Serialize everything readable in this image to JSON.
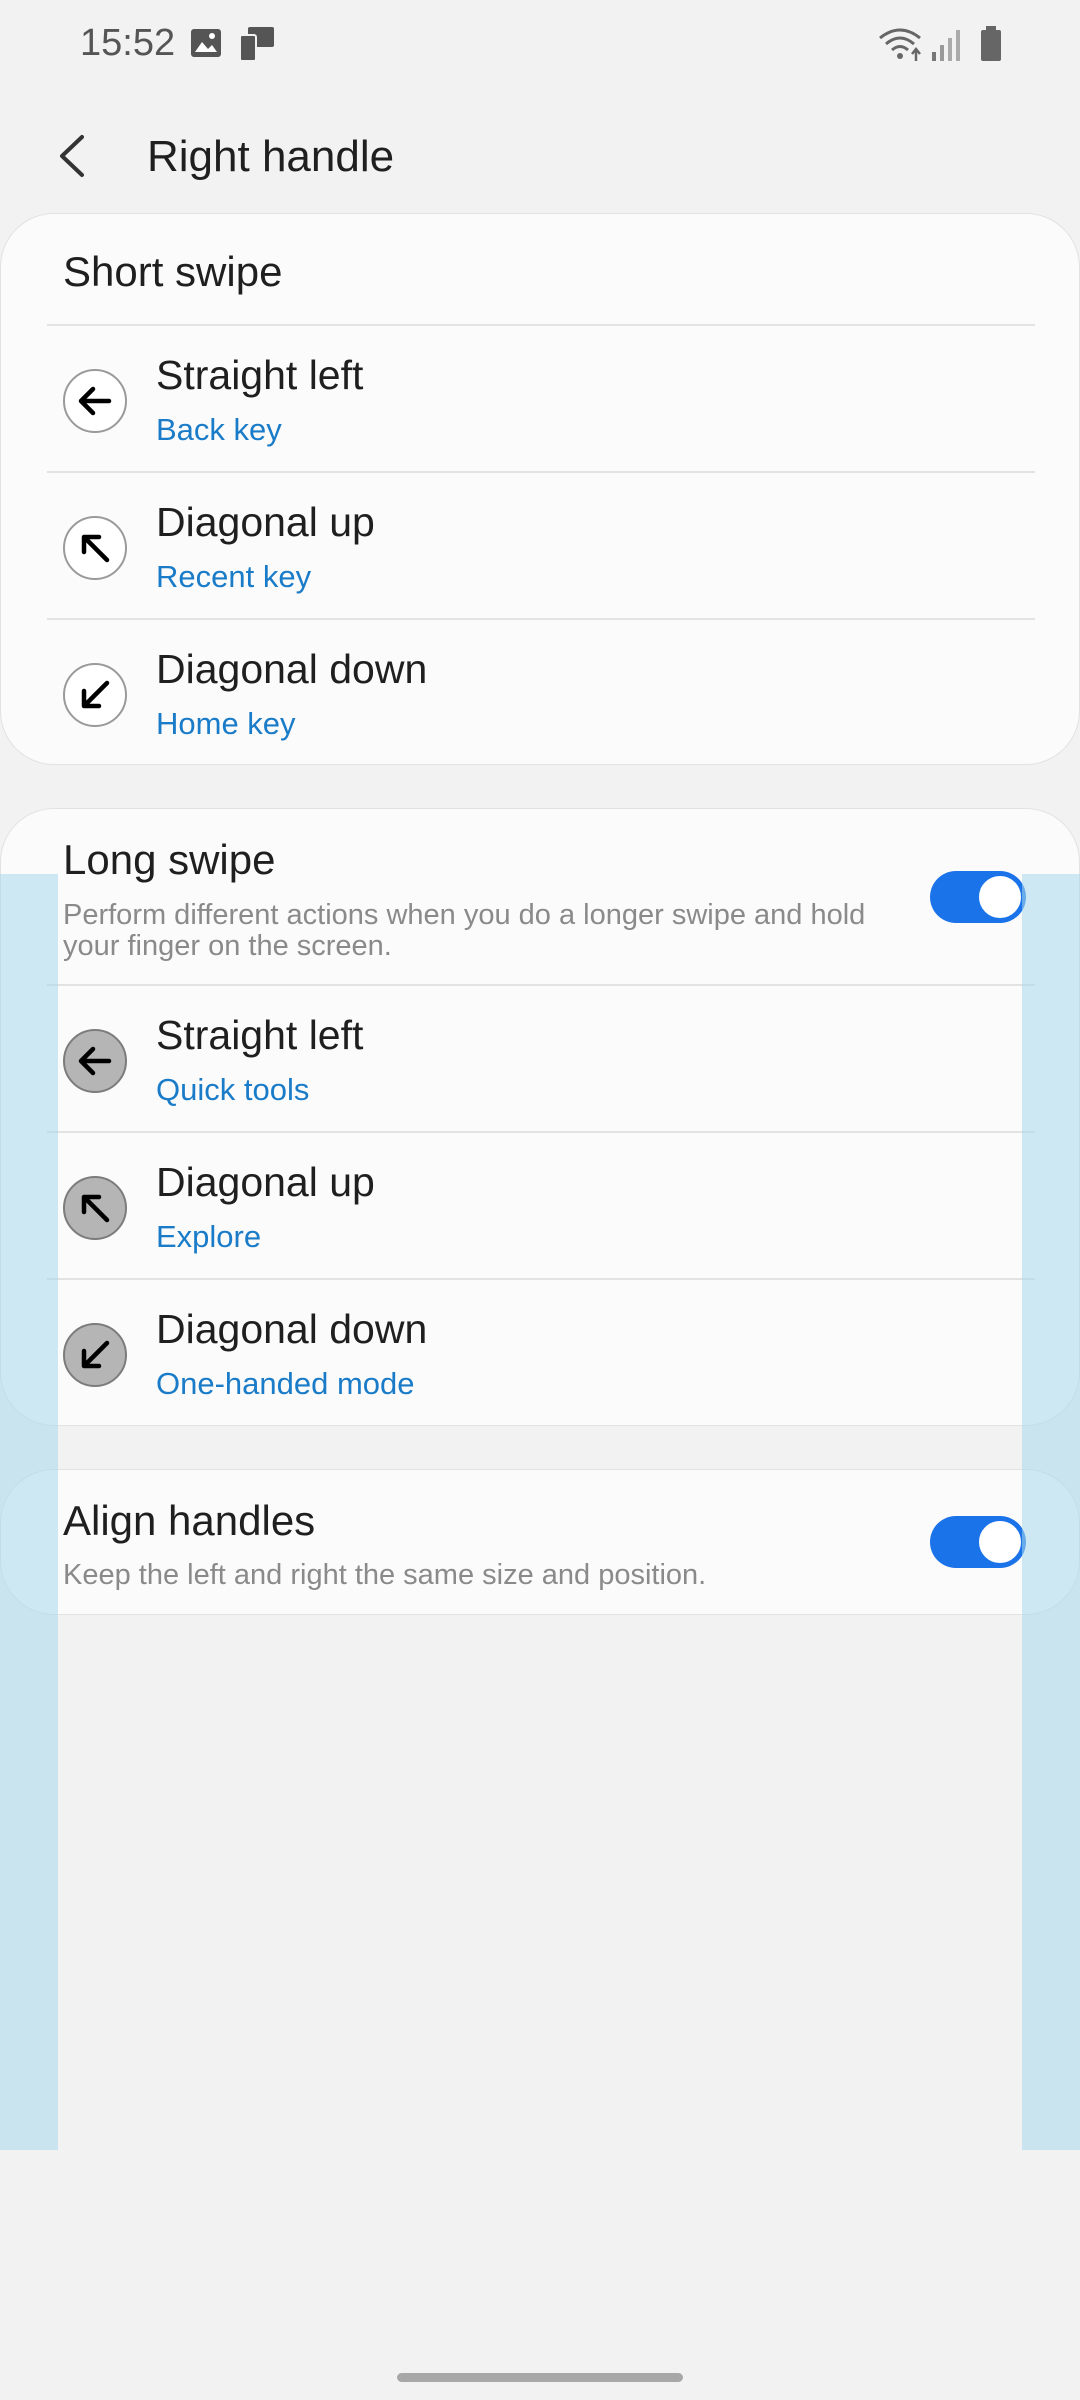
{
  "status_bar": {
    "time": "15:52",
    "icons": [
      "image-icon",
      "device-icon",
      "wifi-icon",
      "signal-icon",
      "battery-icon"
    ]
  },
  "header": {
    "title": "Right handle",
    "back_icon": "chevron-left-icon"
  },
  "short_swipe": {
    "title": "Short swipe",
    "items": [
      {
        "title": "Straight left",
        "value": "Back key",
        "icon": "arrow-left-icon"
      },
      {
        "title": "Diagonal up",
        "value": "Recent key",
        "icon": "arrow-up-left-icon"
      },
      {
        "title": "Diagonal down",
        "value": "Home key",
        "icon": "arrow-down-left-icon"
      }
    ]
  },
  "long_swipe": {
    "title": "Long swipe",
    "description": "Perform different actions when you do a longer swipe and hold your finger on the screen.",
    "enabled": true,
    "items": [
      {
        "title": "Straight left",
        "value": "Quick tools",
        "icon": "arrow-left-icon"
      },
      {
        "title": "Diagonal up",
        "value": "Explore",
        "icon": "arrow-up-left-icon"
      },
      {
        "title": "Diagonal down",
        "value": "One-handed mode",
        "icon": "arrow-down-left-icon"
      }
    ]
  },
  "align_handles": {
    "title": "Align handles",
    "description": "Keep the left and right the same size and position.",
    "enabled": true
  },
  "colors": {
    "accent": "#1a73e8",
    "link": "#1a7cc8",
    "background": "#f2f2f2",
    "overlay": "#aad8ec"
  }
}
